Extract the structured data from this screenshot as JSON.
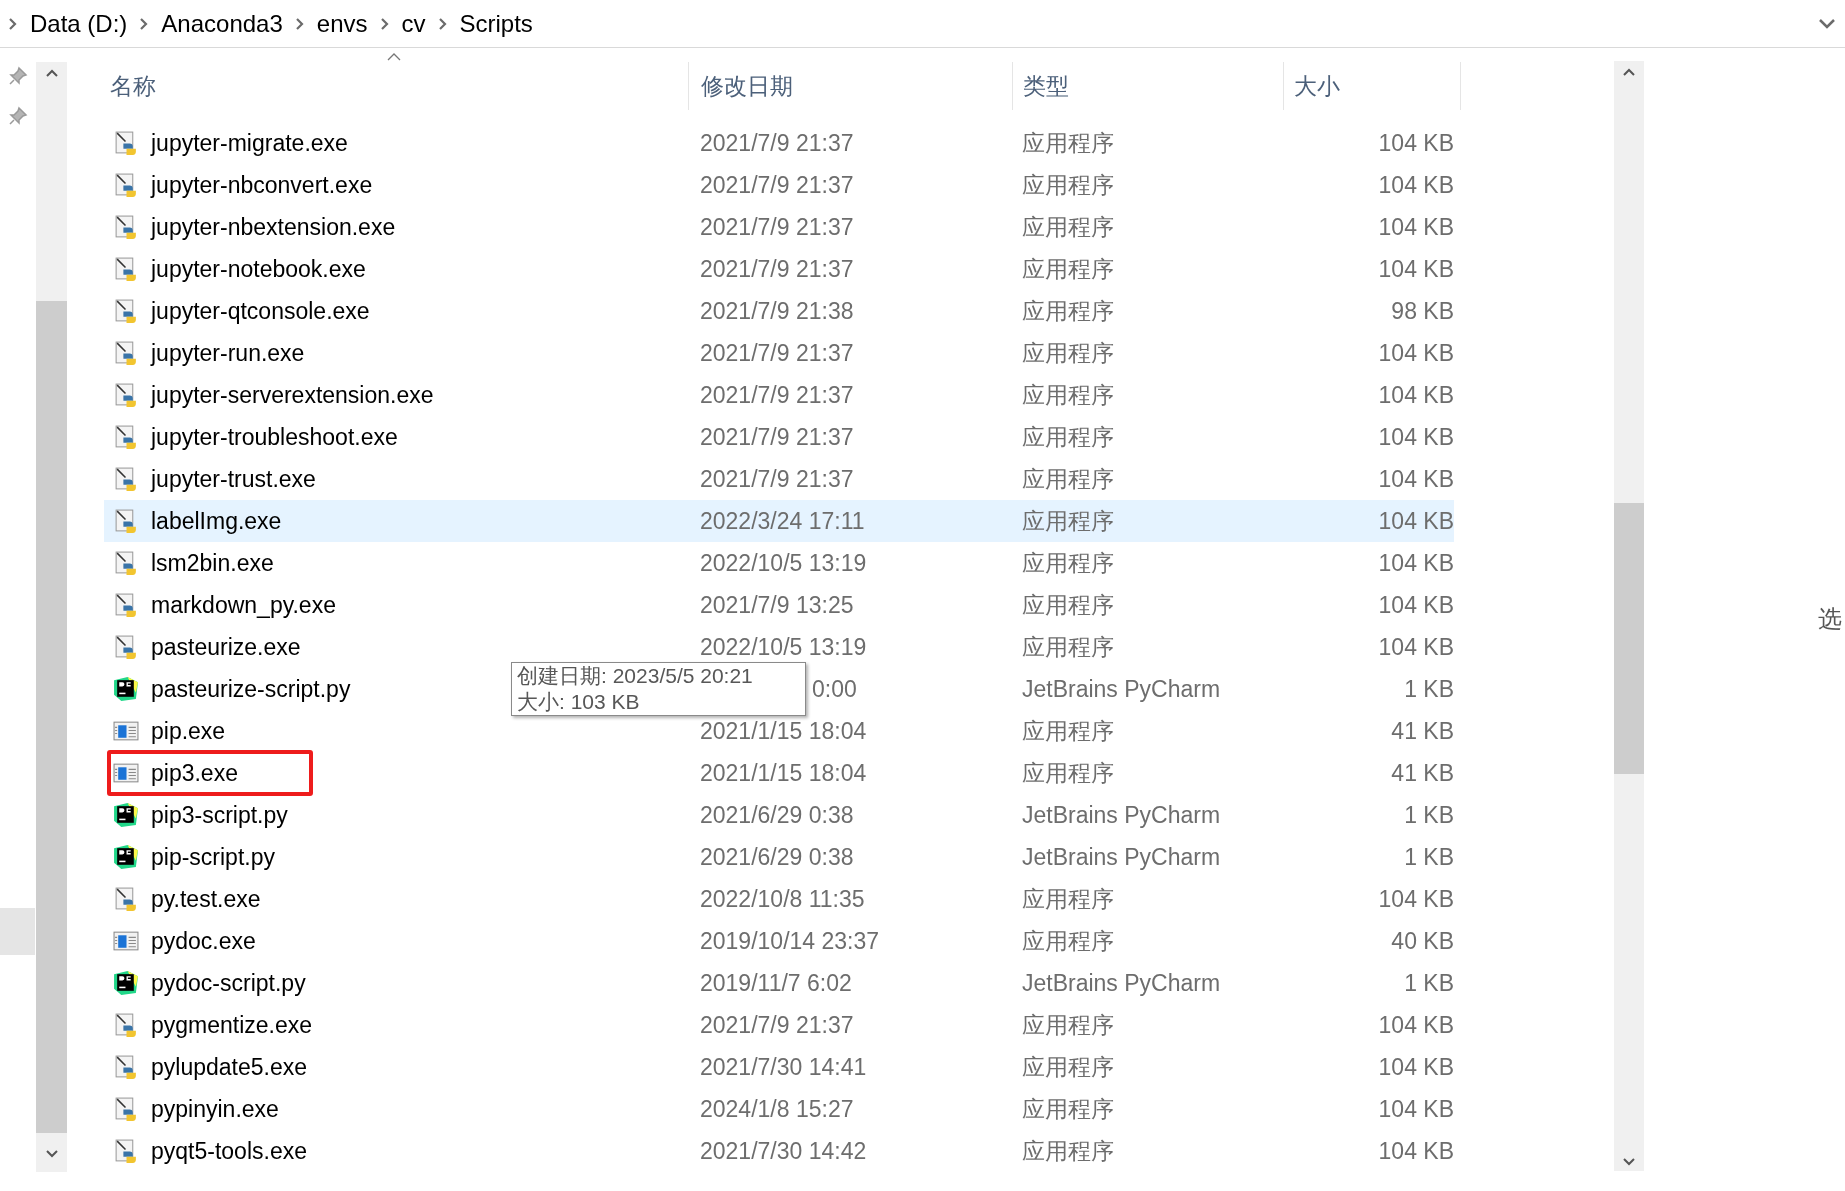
{
  "address_bar": {
    "breadcrumbs": [
      "Data (D:)",
      "Anaconda3",
      "envs",
      "cv",
      "Scripts"
    ]
  },
  "columns": [
    "名称",
    "修改日期",
    "类型",
    "大小"
  ],
  "rows": [
    {
      "kind": "python-exe",
      "name": "jupyter-migrate.exe",
      "date": "2021/7/9 21:37",
      "type": "应用程序",
      "size": "104 KB",
      "selected": false,
      "outlined": false,
      "date_covered": false
    },
    {
      "kind": "python-exe",
      "name": "jupyter-nbconvert.exe",
      "date": "2021/7/9 21:37",
      "type": "应用程序",
      "size": "104 KB",
      "selected": false,
      "outlined": false,
      "date_covered": false
    },
    {
      "kind": "python-exe",
      "name": "jupyter-nbextension.exe",
      "date": "2021/7/9 21:37",
      "type": "应用程序",
      "size": "104 KB",
      "selected": false,
      "outlined": false,
      "date_covered": false
    },
    {
      "kind": "python-exe",
      "name": "jupyter-notebook.exe",
      "date": "2021/7/9 21:37",
      "type": "应用程序",
      "size": "104 KB",
      "selected": false,
      "outlined": false,
      "date_covered": false
    },
    {
      "kind": "python-exe",
      "name": "jupyter-qtconsole.exe",
      "date": "2021/7/9 21:38",
      "type": "应用程序",
      "size": "98 KB",
      "selected": false,
      "outlined": false,
      "date_covered": false
    },
    {
      "kind": "python-exe",
      "name": "jupyter-run.exe",
      "date": "2021/7/9 21:37",
      "type": "应用程序",
      "size": "104 KB",
      "selected": false,
      "outlined": false,
      "date_covered": false
    },
    {
      "kind": "python-exe",
      "name": "jupyter-serverextension.exe",
      "date": "2021/7/9 21:37",
      "type": "应用程序",
      "size": "104 KB",
      "selected": false,
      "outlined": false,
      "date_covered": false
    },
    {
      "kind": "python-exe",
      "name": "jupyter-troubleshoot.exe",
      "date": "2021/7/9 21:37",
      "type": "应用程序",
      "size": "104 KB",
      "selected": false,
      "outlined": false,
      "date_covered": false
    },
    {
      "kind": "python-exe",
      "name": "jupyter-trust.exe",
      "date": "2021/7/9 21:37",
      "type": "应用程序",
      "size": "104 KB",
      "selected": false,
      "outlined": false,
      "date_covered": false
    },
    {
      "kind": "python-exe",
      "name": "labelImg.exe",
      "date": "2022/3/24 17:11",
      "type": "应用程序",
      "size": "104 KB",
      "selected": true,
      "outlined": false,
      "date_covered": false
    },
    {
      "kind": "python-exe",
      "name": "lsm2bin.exe",
      "date": "2022/10/5 13:19",
      "type": "应用程序",
      "size": "104 KB",
      "selected": false,
      "outlined": false,
      "date_covered": false
    },
    {
      "kind": "python-exe",
      "name": "markdown_py.exe",
      "date": "2021/7/9 13:25",
      "type": "应用程序",
      "size": "104 KB",
      "selected": false,
      "outlined": false,
      "date_covered": false
    },
    {
      "kind": "python-exe",
      "name": "pasteurize.exe",
      "date": "2022/10/5 13:19",
      "type": "应用程序",
      "size": "104 KB",
      "selected": false,
      "outlined": false,
      "date_covered": false
    },
    {
      "kind": "pycharm",
      "name": "pasteurize-script.py",
      "date": "0:00",
      "type": "JetBrains PyCharm",
      "size": "1 KB",
      "selected": false,
      "outlined": false,
      "date_covered": true
    },
    {
      "kind": "app",
      "name": "pip.exe",
      "date": "2021/1/15 18:04",
      "type": "应用程序",
      "size": "41 KB",
      "selected": false,
      "outlined": false,
      "date_covered": false
    },
    {
      "kind": "app",
      "name": "pip3.exe",
      "date": "2021/1/15 18:04",
      "type": "应用程序",
      "size": "41 KB",
      "selected": false,
      "outlined": true,
      "date_covered": false
    },
    {
      "kind": "pycharm",
      "name": "pip3-script.py",
      "date": "2021/6/29 0:38",
      "type": "JetBrains PyCharm",
      "size": "1 KB",
      "selected": false,
      "outlined": false,
      "date_covered": false
    },
    {
      "kind": "pycharm",
      "name": "pip-script.py",
      "date": "2021/6/29 0:38",
      "type": "JetBrains PyCharm",
      "size": "1 KB",
      "selected": false,
      "outlined": false,
      "date_covered": false
    },
    {
      "kind": "python-exe",
      "name": "py.test.exe",
      "date": "2022/10/8 11:35",
      "type": "应用程序",
      "size": "104 KB",
      "selected": false,
      "outlined": false,
      "date_covered": false
    },
    {
      "kind": "app",
      "name": "pydoc.exe",
      "date": "2019/10/14 23:37",
      "type": "应用程序",
      "size": "40 KB",
      "selected": false,
      "outlined": false,
      "date_covered": false
    },
    {
      "kind": "pycharm",
      "name": "pydoc-script.py",
      "date": "2019/11/7 6:02",
      "type": "JetBrains PyCharm",
      "size": "1 KB",
      "selected": false,
      "outlined": false,
      "date_covered": false
    },
    {
      "kind": "python-exe",
      "name": "pygmentize.exe",
      "date": "2021/7/9 21:37",
      "type": "应用程序",
      "size": "104 KB",
      "selected": false,
      "outlined": false,
      "date_covered": false
    },
    {
      "kind": "python-exe",
      "name": "pylupdate5.exe",
      "date": "2021/7/30 14:41",
      "type": "应用程序",
      "size": "104 KB",
      "selected": false,
      "outlined": false,
      "date_covered": false
    },
    {
      "kind": "python-exe",
      "name": "pypinyin.exe",
      "date": "2024/1/8 15:27",
      "type": "应用程序",
      "size": "104 KB",
      "selected": false,
      "outlined": false,
      "date_covered": false
    },
    {
      "kind": "python-exe",
      "name": "pyqt5-tools.exe",
      "date": "2021/7/30 14:42",
      "type": "应用程序",
      "size": "104 KB",
      "selected": false,
      "outlined": false,
      "date_covered": false
    }
  ],
  "tooltip": {
    "lines": [
      "创建日期: 2023/5/5 20:21",
      "大小: 103 KB"
    ]
  },
  "details_pane": {
    "text": "选"
  }
}
